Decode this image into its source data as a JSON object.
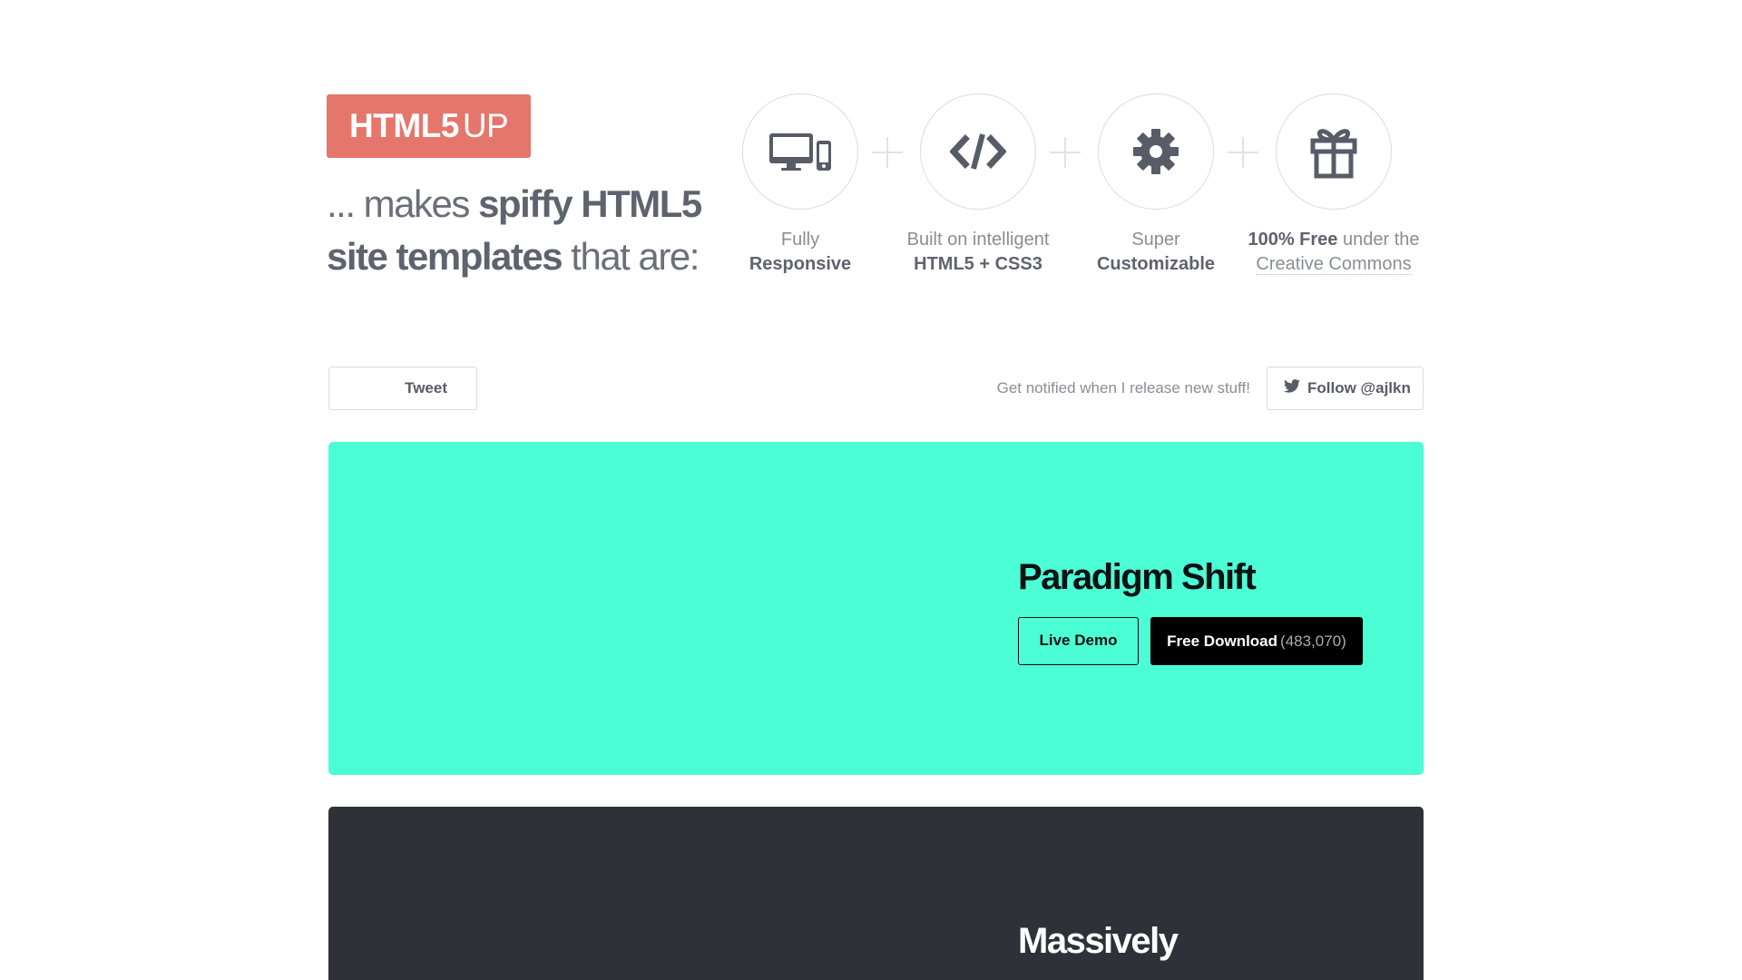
{
  "logo": {
    "bold": "HTML5",
    "light": "UP",
    "bg_color": "#e5766c"
  },
  "tagline": {
    "part1": "... makes ",
    "part2": "spiffy HTML5",
    "part3": "site templates",
    "part4": " that are:"
  },
  "features": [
    {
      "icon": "devices-icon",
      "line1": "Fully",
      "line2": "Responsive"
    },
    {
      "icon": "code-icon",
      "line1": "Built on intelligent",
      "line2": "HTML5 + CSS3"
    },
    {
      "icon": "gear-icon",
      "line1": "Super",
      "line2": "Customizable"
    },
    {
      "icon": "gift-icon",
      "bold": "100% Free",
      "rest": " under the",
      "line2": "Creative Commons"
    }
  ],
  "social": {
    "tweet_label": "Tweet",
    "notify_text": "Get notified when I release new stuff!",
    "follow_label": "Follow @ajlkn"
  },
  "templates": [
    {
      "name": "Paradigm Shift",
      "bg_color": "#4cfed5",
      "demo_label": "Live Demo",
      "download_label": "Free Download",
      "download_count": "(483,070)"
    },
    {
      "name": "Massively",
      "bg_color": "#2e3138"
    }
  ]
}
